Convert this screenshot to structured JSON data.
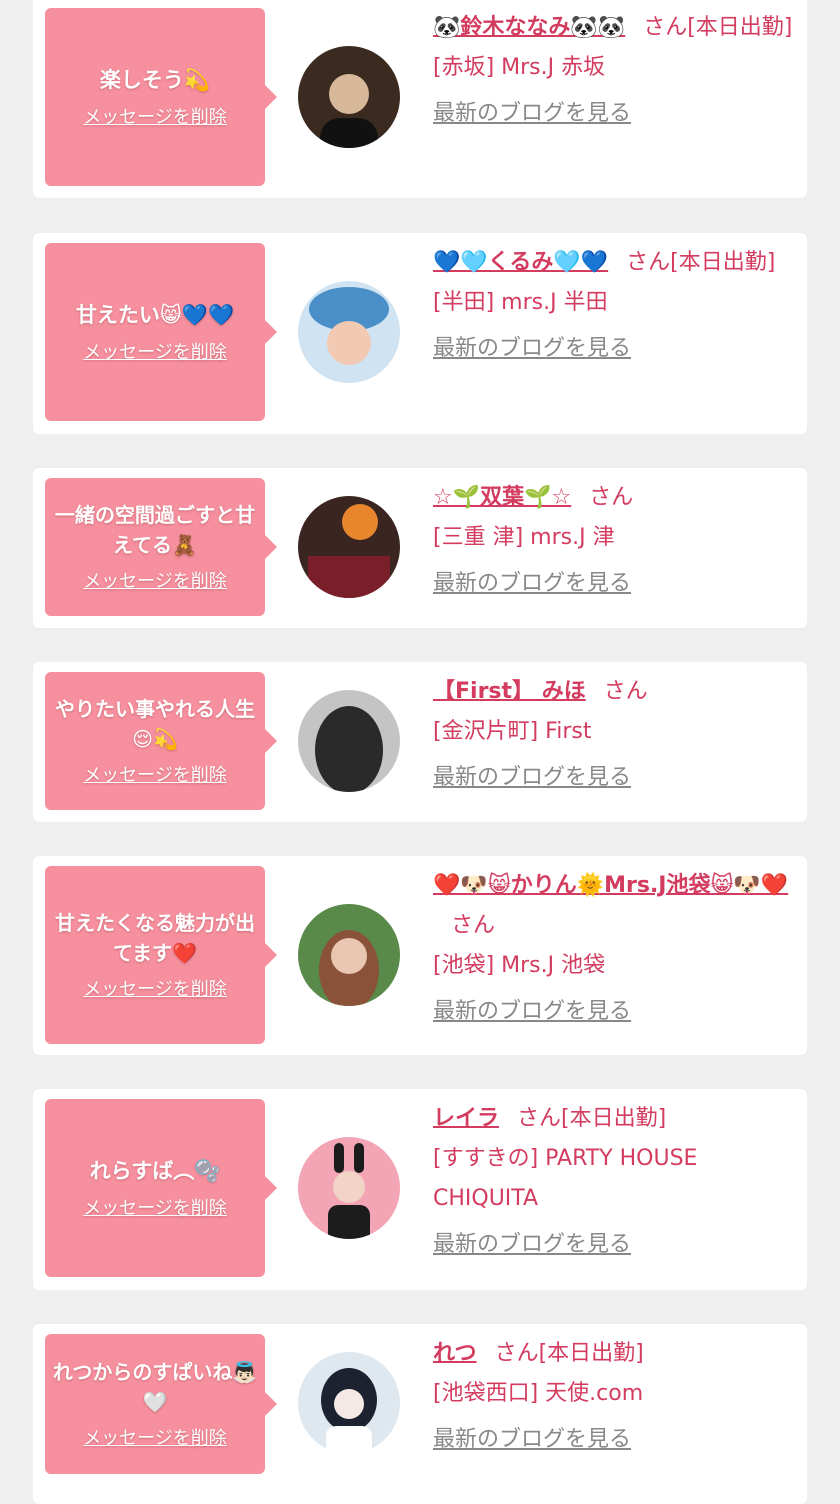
{
  "items": [
    {
      "message": "楽しそう💫",
      "delete_label": "メッセージを削除",
      "name": "🐼鈴木ななみ🐼🐼",
      "suffix": "さん[本日出勤]",
      "shop": "[赤坂] Mrs.J 赤坂",
      "blog_label": "最新のブログを見る",
      "avatar_colors": [
        "#3a2a20",
        "#d8b89a"
      ]
    },
    {
      "message": "甘えたい😸💙💙",
      "delete_label": "メッセージを削除",
      "name": "💙🩵くるみ🩵💙",
      "suffix": "さん[本日出勤]",
      "shop": "[半田] mrs.J 半田",
      "blog_label": "最新のブログを見る",
      "avatar_colors": [
        "#4a8fc8",
        "#f2c9b3"
      ]
    },
    {
      "message": "一緒の空間過ごすと甘えてる🧸",
      "delete_label": "メッセージを削除",
      "name": "☆🌱双葉🌱☆",
      "suffix": "さん",
      "shop": "[三重 津] mrs.J 津",
      "blog_label": "最新のブログを見る",
      "avatar_colors": [
        "#3b2520",
        "#e8862e"
      ]
    },
    {
      "message": "やりたい事やれる人生😌💫",
      "delete_label": "メッセージを削除",
      "name": "【First】 みほ",
      "suffix": "さん",
      "shop": "[金沢片町] First",
      "blog_label": "最新のブログを見る",
      "avatar_colors": [
        "#2a2a2a",
        "#b9b9b9"
      ]
    },
    {
      "message": "甘えたくなる魅力が出てます❤️",
      "delete_label": "メッセージを削除",
      "name": "❤️🐶😸かりん🌞Mrs.J池袋😸🐶❤️",
      "suffix": "さん",
      "shop": "[池袋] Mrs.J 池袋",
      "blog_label": "最新のブログを見る",
      "avatar_colors": [
        "#5a8a4a",
        "#e9c6b2"
      ]
    },
    {
      "message": "れらすば︵🫧",
      "delete_label": "メッセージを削除",
      "name": "レイラ",
      "suffix": "さん[本日出勤]",
      "shop": "[すすきの] PARTY HOUSE CHIQUITA",
      "blog_label": "最新のブログを見る",
      "avatar_colors": [
        "#f3a4b5",
        "#1c1c1c"
      ]
    },
    {
      "message": "れつからのすぱいね👼🏻🤍",
      "delete_label": "メッセージを削除",
      "name": "れつ",
      "suffix": "さん[本日出勤]",
      "shop": "[池袋西口] 天使.com",
      "blog_label": "最新のブログを見る",
      "avatar_colors": [
        "#1c2230",
        "#f5e9e6"
      ]
    }
  ],
  "colors": {
    "bubble": "#f7909e",
    "name": "#d33c5f",
    "link_gray": "#888888",
    "background": "#efefef"
  }
}
